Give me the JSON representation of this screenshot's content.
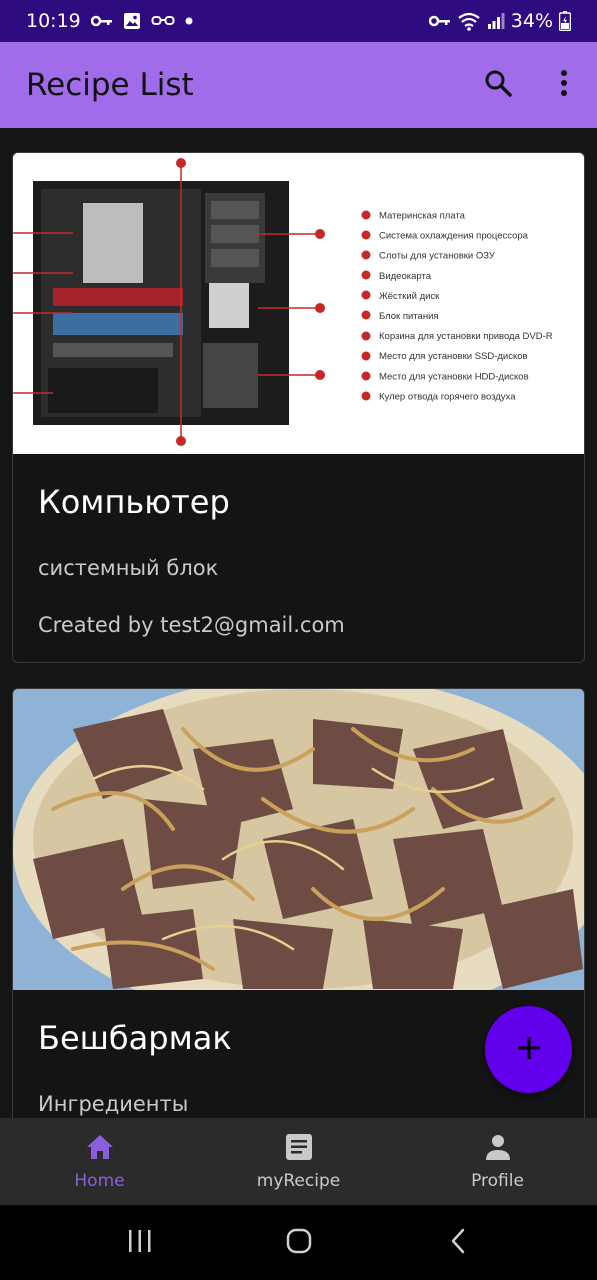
{
  "status_bar": {
    "time": "10:19",
    "battery": "34%"
  },
  "app_bar": {
    "title": "Recipe List"
  },
  "recipes": [
    {
      "title": "Компьютер",
      "description": "системный блок",
      "author": "Created by test2@gmail.com",
      "image_legend": [
        "Материнская плата",
        "Система охлаждения процессора",
        "Слоты для установки ОЗУ",
        "Видеокарта",
        "Жёсткий диск",
        "Блок питания",
        "Корзина для установки привода DVD-R",
        "Место для установки SSD-дисков",
        "Место для установки HDD-дисков",
        "Кулер отвода горячего воздуха"
      ]
    },
    {
      "title": "Бешбармак",
      "description": "Ингредиенты"
    }
  ],
  "bottom_nav": [
    {
      "label": "Home",
      "icon": "home-icon",
      "active": true
    },
    {
      "label": "myRecipe",
      "icon": "article-icon",
      "active": false
    },
    {
      "label": "Profile",
      "icon": "person-icon",
      "active": false
    }
  ],
  "colors": {
    "status_bar": "#2e0c80",
    "app_bar": "#a16cea",
    "fab": "#6200ee",
    "nav_active": "#8b5fdc",
    "background": "#151515"
  }
}
